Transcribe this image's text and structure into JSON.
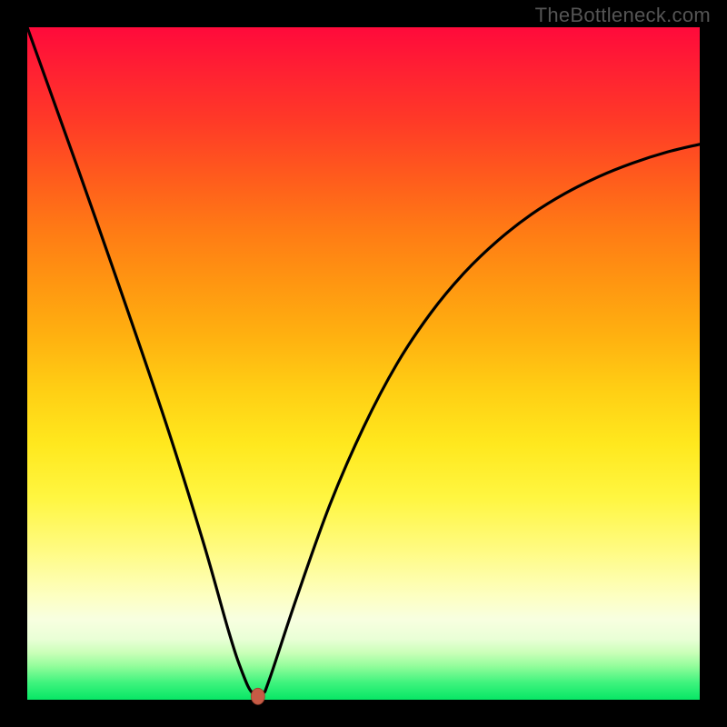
{
  "watermark": "TheBottleneck.com",
  "colors": {
    "page_bg": "#000000",
    "curve": "#000000",
    "marker_fill": "#c65b45",
    "marker_stroke": "#9a3f2e",
    "gradient_stops": [
      {
        "offset": 0.0,
        "color": "#ff0a3b"
      },
      {
        "offset": 0.14,
        "color": "#ff3a27"
      },
      {
        "offset": 0.3,
        "color": "#ff7a15"
      },
      {
        "offset": 0.46,
        "color": "#ffb110"
      },
      {
        "offset": 0.62,
        "color": "#ffe81e"
      },
      {
        "offset": 0.78,
        "color": "#fffb84"
      },
      {
        "offset": 0.88,
        "color": "#f8ffe0"
      },
      {
        "offset": 0.95,
        "color": "#93fd9b"
      },
      {
        "offset": 1.0,
        "color": "#07e765"
      }
    ]
  },
  "chart_data": {
    "type": "line",
    "title": "",
    "xlabel": "",
    "ylabel": "",
    "xlim": [
      0,
      100
    ],
    "ylim": [
      0,
      100
    ],
    "grid": false,
    "legend": false,
    "series": [
      {
        "name": "curve",
        "x": [
          0,
          10,
          20,
          26,
          30,
          32,
          33.5,
          35,
          36,
          40,
          45,
          50,
          55,
          60,
          65,
          70,
          75,
          80,
          85,
          90,
          95,
          100
        ],
        "y": [
          100,
          72,
          43,
          24,
          10,
          4,
          1,
          1,
          3,
          15,
          29,
          40.5,
          50,
          57.5,
          63.5,
          68.3,
          72.2,
          75.3,
          77.8,
          79.8,
          81.4,
          82.6
        ]
      }
    ],
    "annotations": [
      {
        "name": "min-marker",
        "x": 34.3,
        "y": 0.5
      }
    ],
    "notes": "V-shaped bottleneck curve over a vertical heat gradient (red at top = high bottleneck, green at bottom = low). Minimum near x≈34 at y≈0."
  }
}
